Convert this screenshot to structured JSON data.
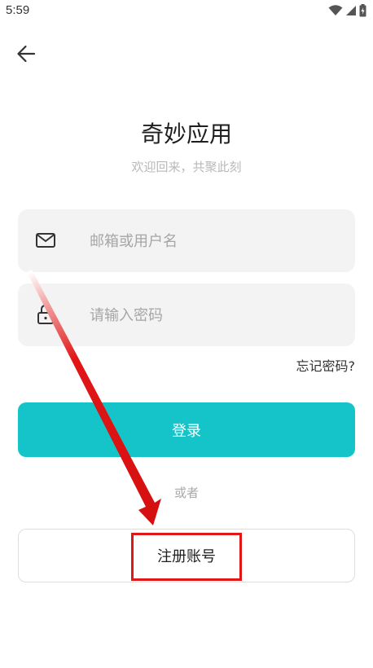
{
  "status_bar": {
    "time": "5:59",
    "icons": [
      "wifi-icon",
      "cellular-signal-icon",
      "battery-charging-icon"
    ]
  },
  "nav": {
    "back_icon": "arrow-left-icon"
  },
  "header": {
    "title": "奇妙应用",
    "subtitle": "欢迎回来，共聚此刻"
  },
  "form": {
    "email": {
      "icon": "mail-icon",
      "placeholder": "邮箱或用户名",
      "value": ""
    },
    "password": {
      "icon": "lock-icon",
      "placeholder": "请输入密码",
      "value": ""
    },
    "forgot_label": "忘记密码?",
    "login_label": "登录",
    "divider_label": "或者",
    "register_label": "注册账号"
  },
  "colors": {
    "accent": "#15c4c9",
    "annotation": "#e11717",
    "input_bg": "#f3f3f3"
  }
}
